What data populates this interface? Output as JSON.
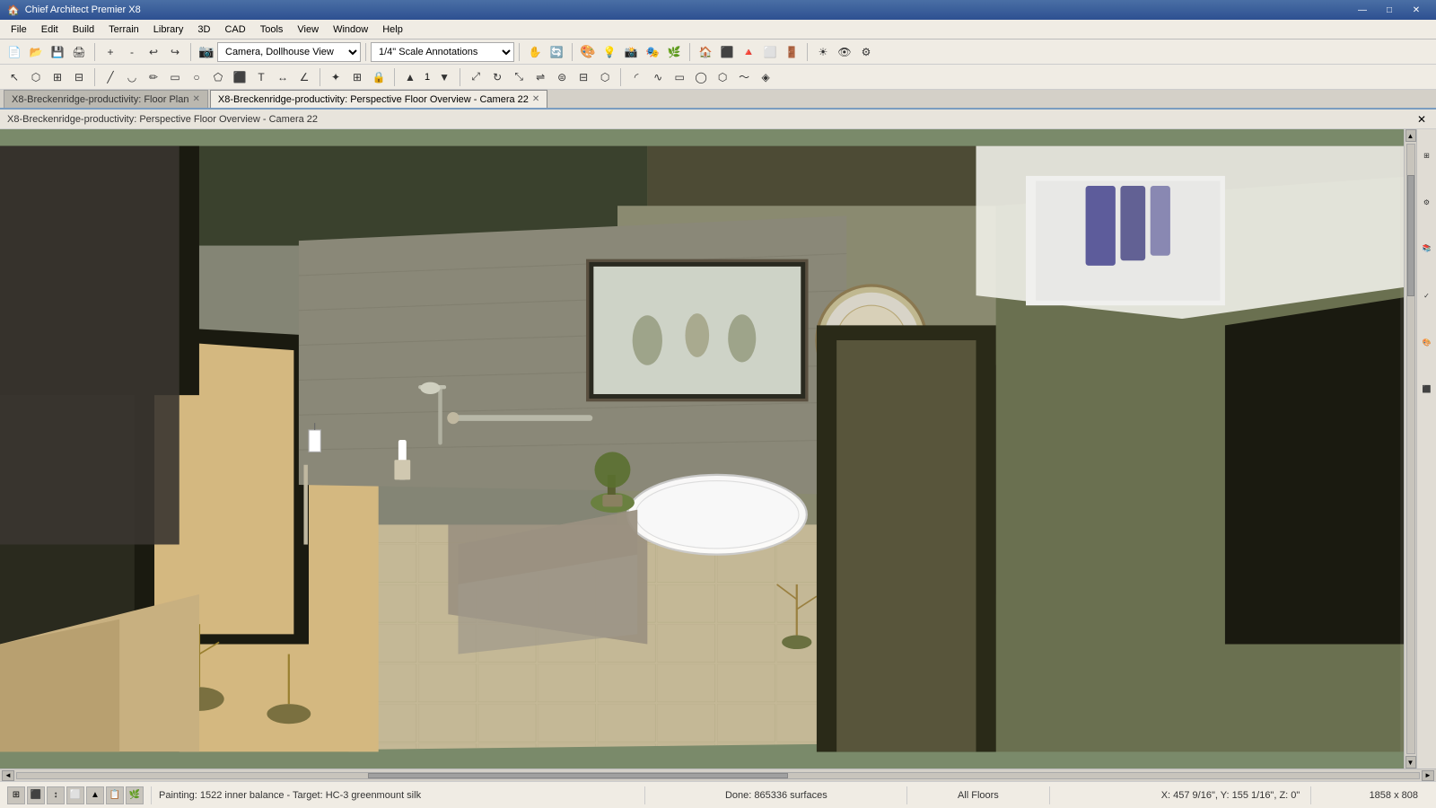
{
  "titleBar": {
    "icon": "🏠",
    "title": "Chief Architect Premier X8",
    "buttons": {
      "minimize": "—",
      "maximize": "□",
      "close": "✕"
    }
  },
  "menuBar": {
    "items": [
      "File",
      "Edit",
      "Build",
      "Terrain",
      "Library",
      "3D",
      "CAD",
      "Tools",
      "View",
      "Window",
      "Help"
    ]
  },
  "toolbar1": {
    "cameraDropdown": "Camera, Dollhouse View",
    "scaleDropdown": "1/4\" Scale Annotations"
  },
  "tabs": [
    {
      "id": "floor-plan",
      "label": "X8-Breckenridge-productivity: Floor Plan",
      "active": false,
      "closable": true
    },
    {
      "id": "perspective",
      "label": "X8-Breckenridge-productivity: Perspective Floor Overview - Camera 22",
      "active": true,
      "closable": true
    }
  ],
  "viewLabel": "X8-Breckenridge-productivity: Perspective Floor Overview - Camera 22",
  "statusBar": {
    "painting": "Painting: 1522 inner balance - Target: HC-3 greenmount silk",
    "done": "Done: 865336 surfaces",
    "floors": "All Floors",
    "coordinates": "X: 457 9/16\", Y: 155 1/16\", Z: 0\"",
    "dimensions": "1858 x 808"
  },
  "scene": {
    "description": "3D Dollhouse view of bathroom/bedroom interior",
    "bgColor": "#6b7a5a"
  }
}
